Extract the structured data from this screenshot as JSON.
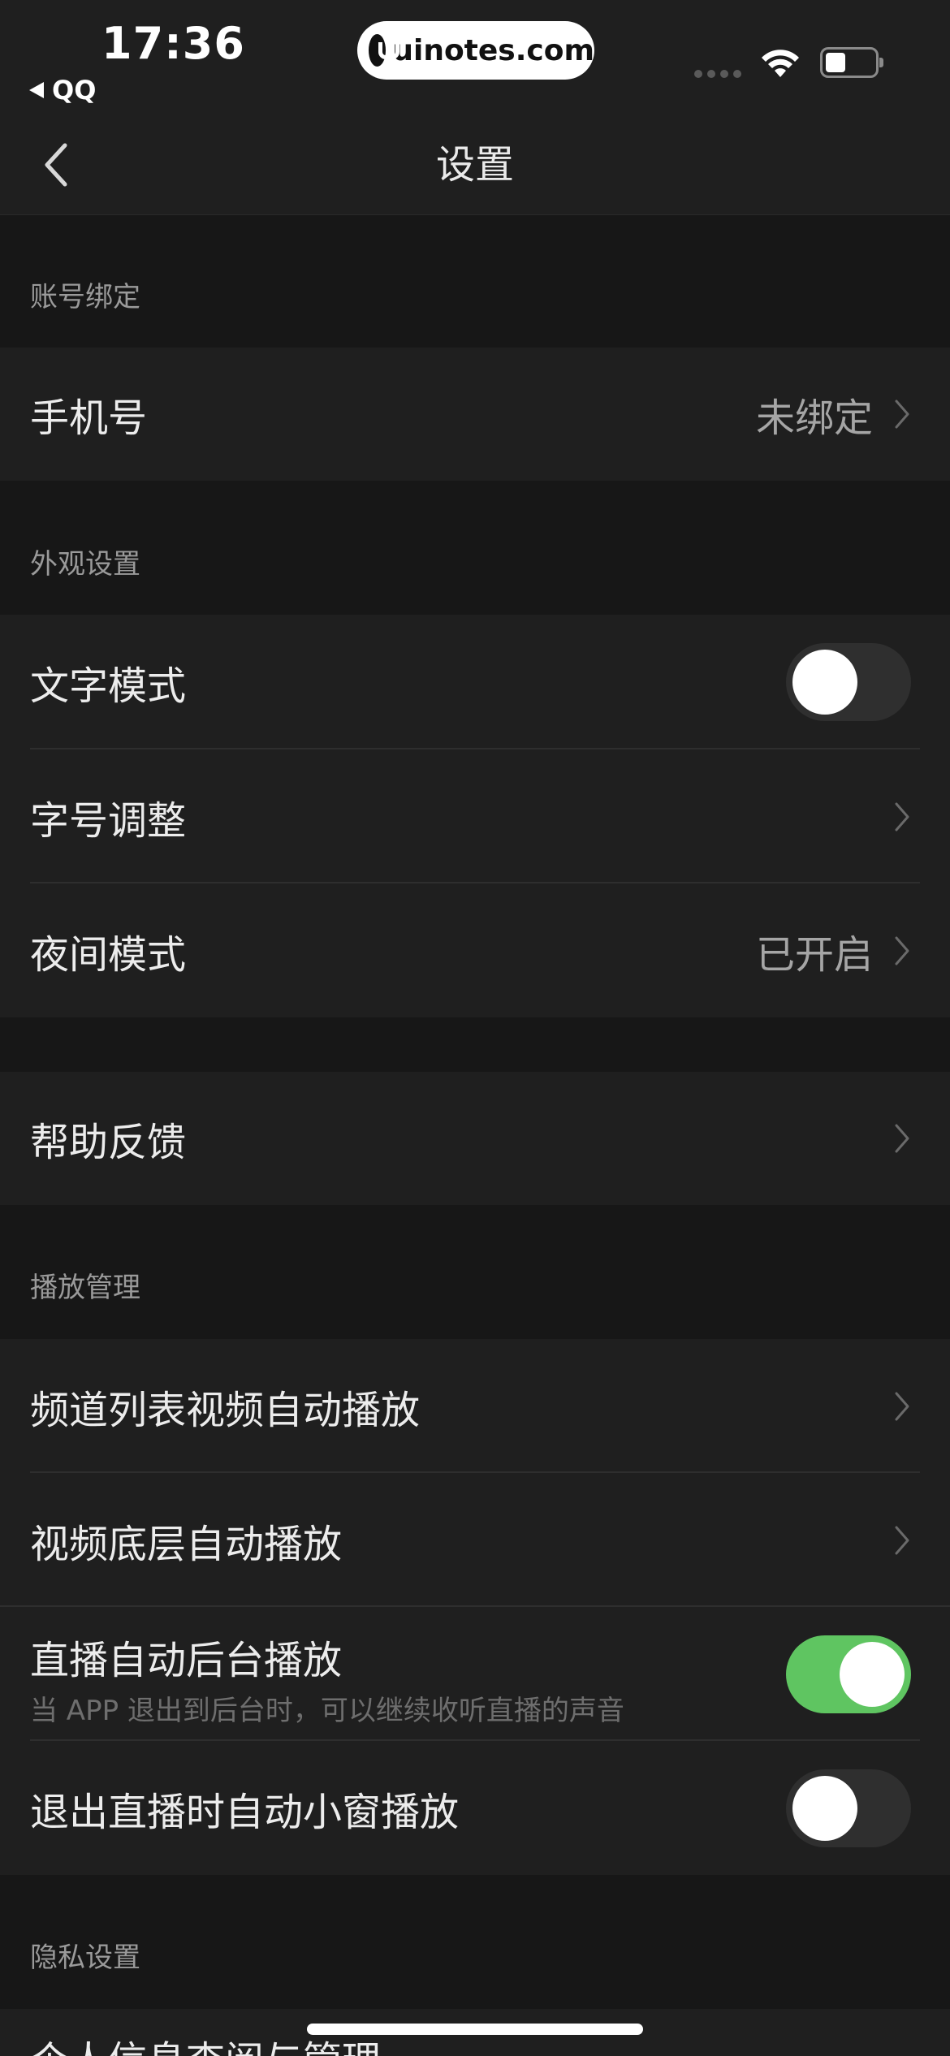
{
  "status_bar": {
    "time": "17:36",
    "back_app": "QQ",
    "url": "uinotes.com"
  },
  "nav": {
    "title": "设置"
  },
  "sections": {
    "account": {
      "header": "账号绑定",
      "phone": {
        "label": "手机号",
        "value": "未绑定"
      }
    },
    "appearance": {
      "header": "外观设置",
      "text_mode": {
        "label": "文字模式",
        "toggle": "off"
      },
      "font_size": {
        "label": "字号调整"
      },
      "night_mode": {
        "label": "夜间模式",
        "value": "已开启"
      }
    },
    "help": {
      "feedback": {
        "label": "帮助反馈"
      }
    },
    "playback": {
      "header": "播放管理",
      "channel_autoplay": {
        "label": "频道列表视频自动播放"
      },
      "video_bottom_autoplay": {
        "label": "视频底层自动播放"
      },
      "live_background": {
        "label": "直播自动后台播放",
        "sublabel": "当 APP 退出到后台时，可以继续收听直播的声音",
        "toggle": "on"
      },
      "live_pip": {
        "label": "退出直播时自动小窗播放",
        "toggle": "off"
      }
    },
    "privacy": {
      "header": "隐私设置",
      "personal_info": {
        "label": "个人信息查阅与管理"
      }
    }
  },
  "colors": {
    "background": "#171717",
    "row_background": "#1f1f1f",
    "toggle_on": "#5fc561",
    "toggle_off": "#2f2f2f"
  }
}
